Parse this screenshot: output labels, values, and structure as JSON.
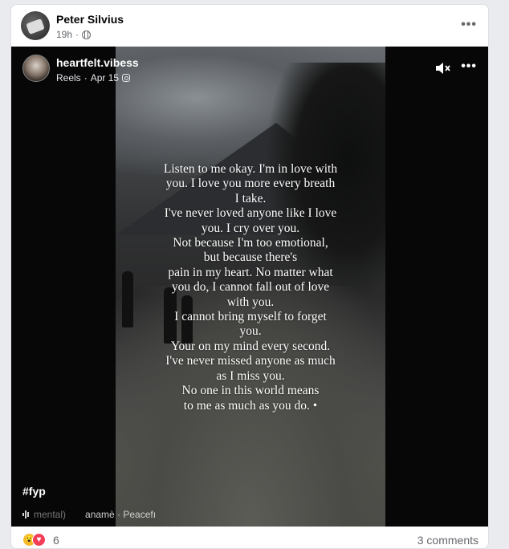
{
  "post": {
    "author": "Peter Silvius",
    "time": "19h",
    "privacy_sep": "·"
  },
  "reel": {
    "author": "heartfelt.vibess",
    "source": "Reels",
    "date": "Apr 15",
    "sep": "·",
    "quote_lines": [
      "Listen to me okay. I'm in love with",
      "you. I love you more every breath",
      "I take.",
      "I've never loved anyone like I love",
      "you. I cry over you.",
      "Not because I'm too emotional,",
      "but because there's",
      "pain in my heart. No matter what",
      "you do, I cannot fall out of love",
      "with you.",
      "I cannot bring myself to forget",
      "you.",
      "Your on my mind every second.",
      "I've never missed anyone as much",
      "as I miss you.",
      "No one in this world means",
      "to me as much as you do. •"
    ],
    "hashtag": "#fyp",
    "audio_faded": "mental)",
    "audio_text": "anamè · Peacefı"
  },
  "footer": {
    "reaction_count": "6",
    "comments": "3 comments"
  },
  "icons": {
    "globe": "globe-icon",
    "more": "more-options-icon",
    "mute": "speaker-muted-icon",
    "instagram": "instagram-icon",
    "audio": "waveform-icon",
    "reactions": [
      "wow-reaction-icon",
      "love-reaction-icon"
    ]
  },
  "colors": {
    "name_text": "#050505",
    "meta_text": "#65676b",
    "video_bg": "#070707",
    "love": "#f33e58",
    "wow": "#f7b928"
  }
}
